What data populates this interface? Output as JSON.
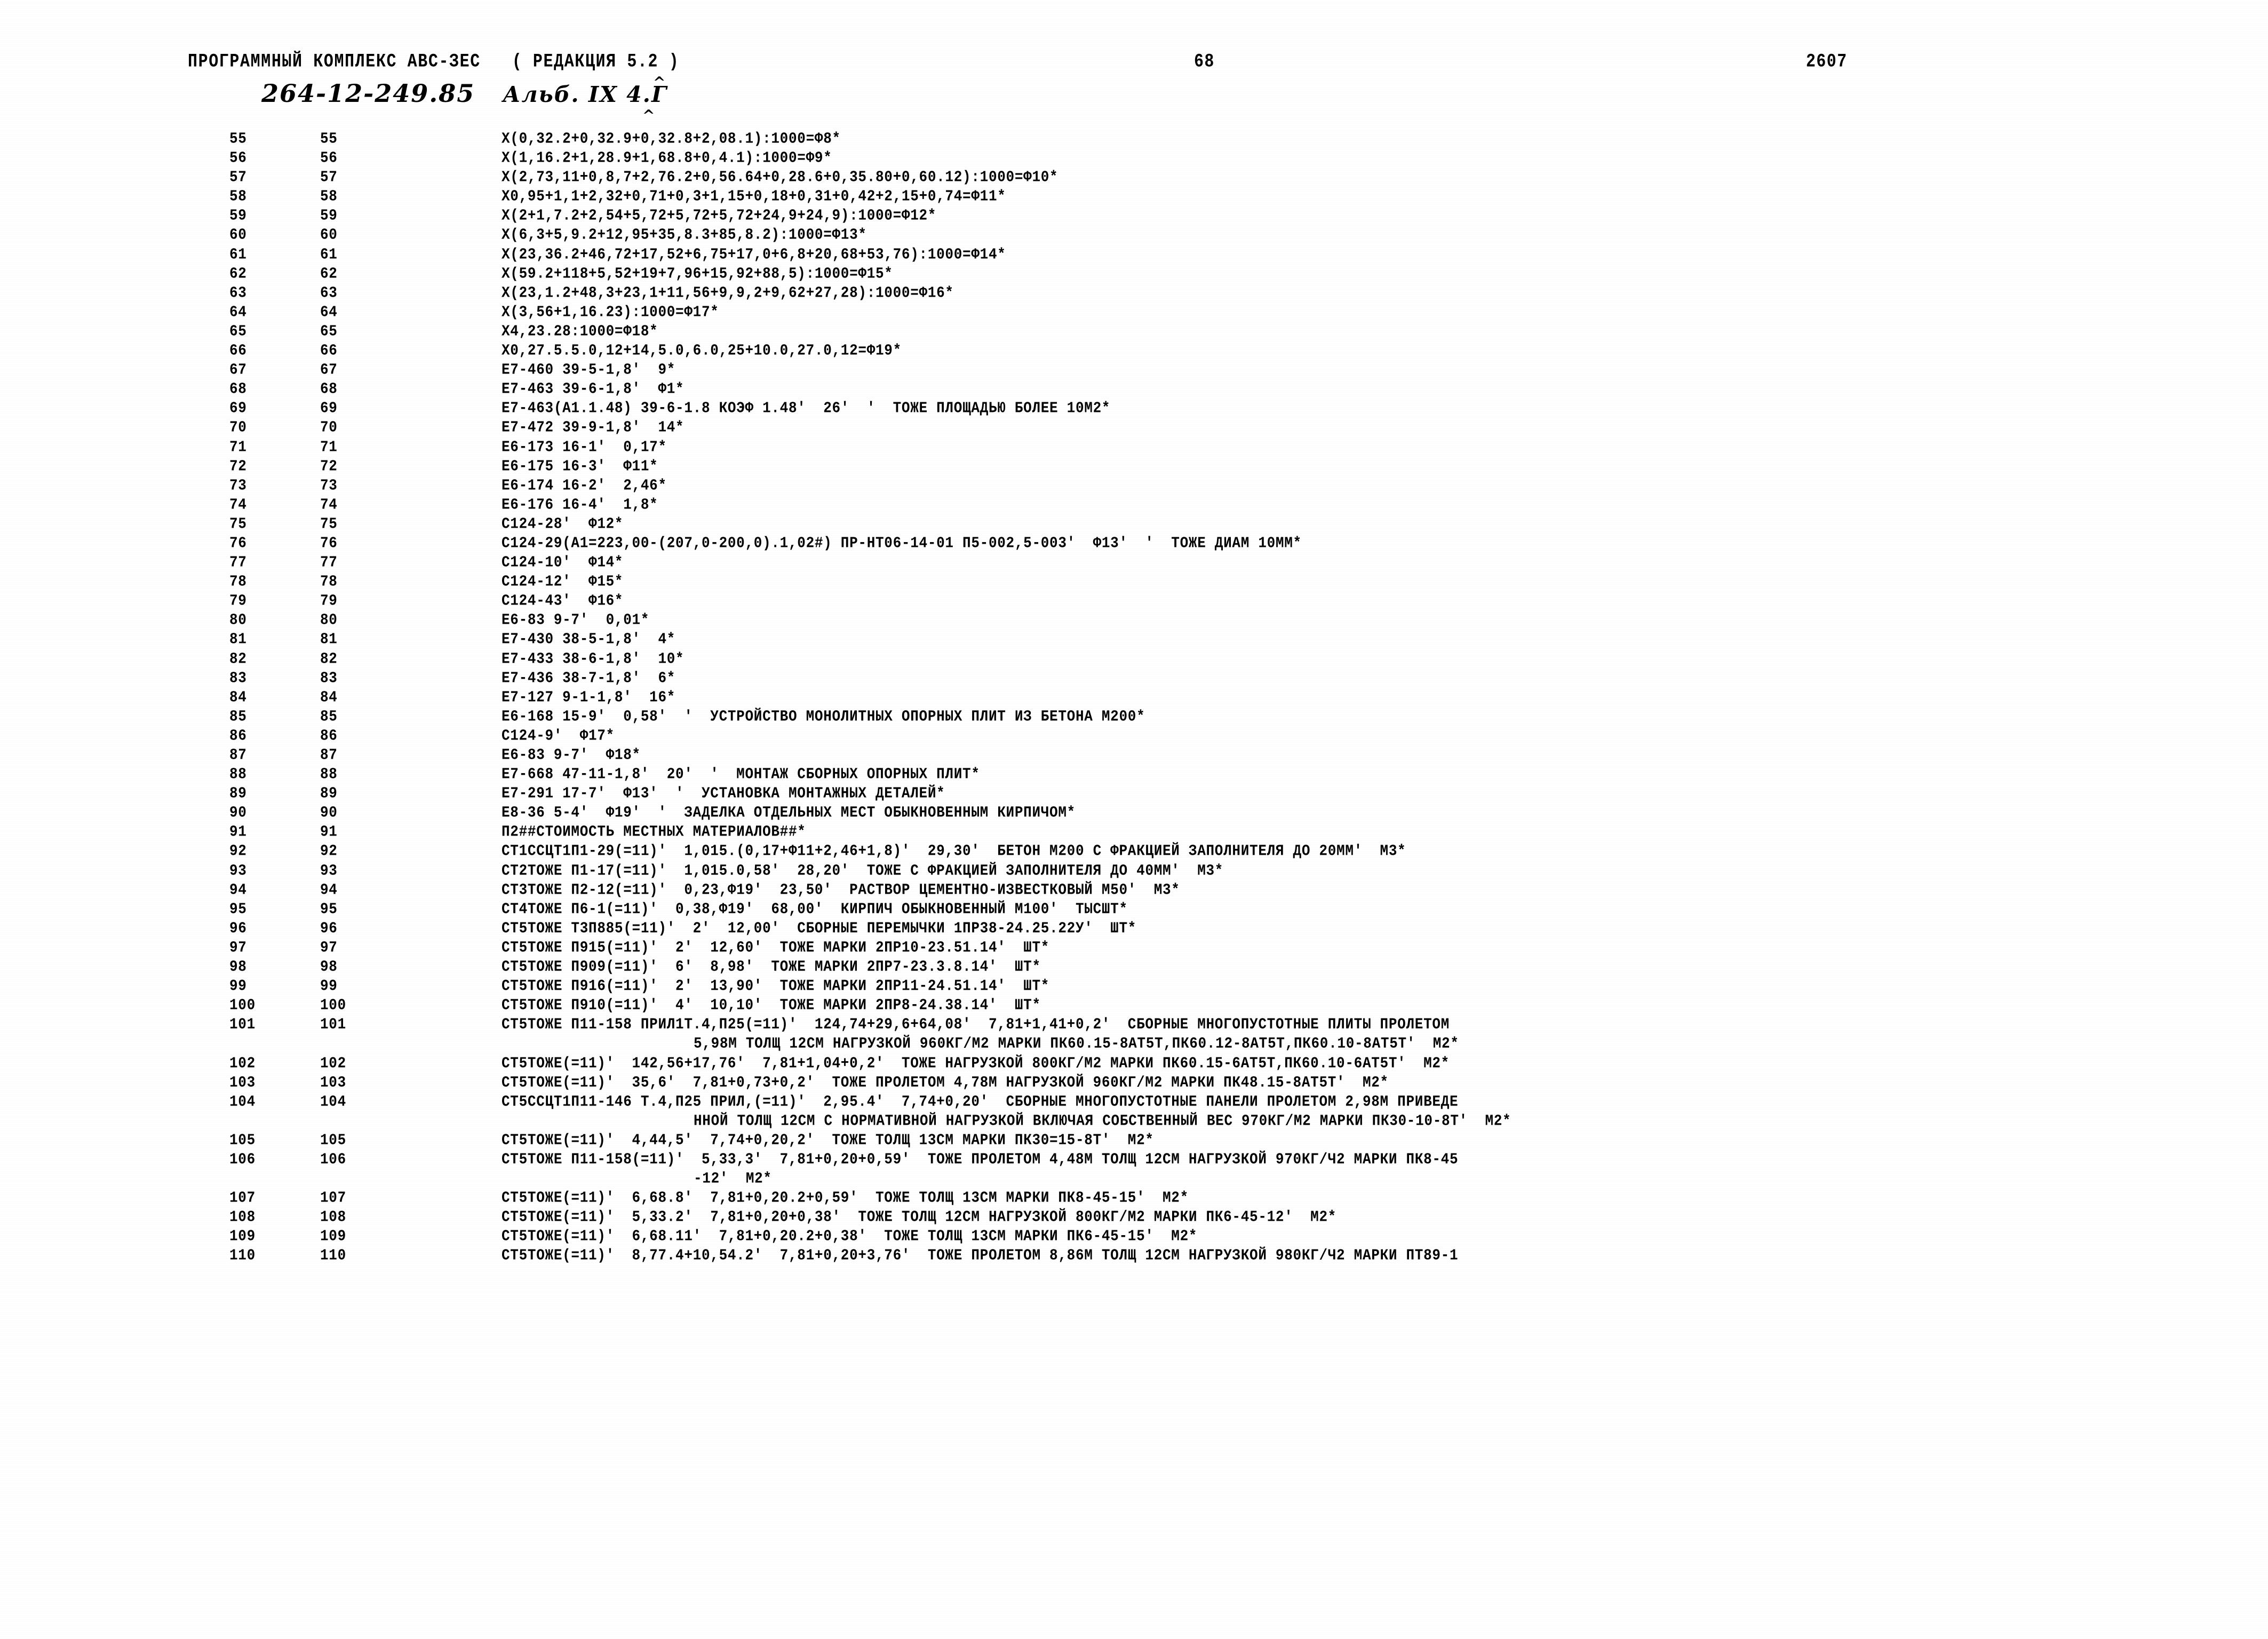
{
  "header": {
    "title": "ПРОГРАММНЫЙ КОМПЛЕКС АВС-ЗЕС   ( РЕДАКЦИЯ 5.2 )",
    "page_number": "68",
    "doc_code": "2607"
  },
  "annotation": {
    "handwritten_code": "264-12-249.85",
    "handwritten_album": "Альб. IX 4.Г",
    "mark_above": "^",
    "mark_below": "^"
  },
  "listing": {
    "rows": [
      {
        "a": "55",
        "b": "55",
        "c": "X(0,32.2+0,32.9+0,32.8+2,08.1):1000=Ф8*"
      },
      {
        "a": "56",
        "b": "56",
        "c": "X(1,16.2+1,28.9+1,68.8+0,4.1):1000=Ф9*"
      },
      {
        "a": "57",
        "b": "57",
        "c": "X(2,73,11+0,8,7+2,76.2+0,56.64+0,28.6+0,35.80+0,60.12):1000=Ф10*"
      },
      {
        "a": "58",
        "b": "58",
        "c": "X0,95+1,1+2,32+0,71+0,3+1,15+0,18+0,31+0,42+2,15+0,74=Ф11*"
      },
      {
        "a": "59",
        "b": "59",
        "c": "X(2+1,7.2+2,54+5,72+5,72+5,72+24,9+24,9):1000=Ф12*"
      },
      {
        "a": "60",
        "b": "60",
        "c": "X(6,3+5,9.2+12,95+35,8.3+85,8.2):1000=Ф13*"
      },
      {
        "a": "61",
        "b": "61",
        "c": "X(23,36.2+46,72+17,52+6,75+17,0+6,8+20,68+53,76):1000=Ф14*"
      },
      {
        "a": "62",
        "b": "62",
        "c": "X(59.2+118+5,52+19+7,96+15,92+88,5):1000=Ф15*"
      },
      {
        "a": "63",
        "b": "63",
        "c": "X(23,1.2+48,3+23,1+11,56+9,9,2+9,62+27,28):1000=Ф16*"
      },
      {
        "a": "64",
        "b": "64",
        "c": "X(3,56+1,16.23):1000=Ф17*"
      },
      {
        "a": "65",
        "b": "65",
        "c": "X4,23.28:1000=Ф18*"
      },
      {
        "a": "66",
        "b": "66",
        "c": "X0,27.5.5.0,12+14,5.0,6.0,25+10.0,27.0,12=Ф19*"
      },
      {
        "a": "67",
        "b": "67",
        "c": "E7-460 39-5-1,8'  9*"
      },
      {
        "a": "68",
        "b": "68",
        "c": "E7-463 39-6-1,8'  Ф1*"
      },
      {
        "a": "69",
        "b": "69",
        "c": "E7-463(A1.1.48) 39-6-1.8 КОЭФ 1.48'  26'  '  ТОЖЕ ПЛОЩАДЬЮ БОЛЕЕ 10М2*"
      },
      {
        "a": "70",
        "b": "70",
        "c": "E7-472 39-9-1,8'  14*"
      },
      {
        "a": "71",
        "b": "71",
        "c": "E6-173 16-1'  0,17*"
      },
      {
        "a": "72",
        "b": "72",
        "c": "E6-175 16-3'  Ф11*"
      },
      {
        "a": "73",
        "b": "73",
        "c": "E6-174 16-2'  2,46*"
      },
      {
        "a": "74",
        "b": "74",
        "c": "E6-176 16-4'  1,8*"
      },
      {
        "a": "75",
        "b": "75",
        "c": "C124-28'  Ф12*"
      },
      {
        "a": "76",
        "b": "76",
        "c": "C124-29(A1=223,00-(207,0-200,0).1,02#) ПР-НТ06-14-01 П5-002,5-003'  Ф13'  '  ТОЖЕ ДИАМ 10ММ*"
      },
      {
        "a": "77",
        "b": "77",
        "c": "C124-10'  Ф14*"
      },
      {
        "a": "78",
        "b": "78",
        "c": "C124-12'  Ф15*"
      },
      {
        "a": "79",
        "b": "79",
        "c": "C124-43'  Ф16*"
      },
      {
        "a": "80",
        "b": "80",
        "c": "E6-83 9-7'  0,01*"
      },
      {
        "a": "81",
        "b": "81",
        "c": "E7-430 38-5-1,8'  4*"
      },
      {
        "a": "82",
        "b": "82",
        "c": "E7-433 38-6-1,8'  10*"
      },
      {
        "a": "83",
        "b": "83",
        "c": "E7-436 38-7-1,8'  6*"
      },
      {
        "a": "84",
        "b": "84",
        "c": "E7-127 9-1-1,8'  16*"
      },
      {
        "a": "85",
        "b": "85",
        "c": "E6-168 15-9'  0,58'  '  УСТРОЙСТВО МОНОЛИТНЫХ ОПОРНЫХ ПЛИТ ИЗ БЕТОНА М200*"
      },
      {
        "a": "86",
        "b": "86",
        "c": "C124-9'  Ф17*"
      },
      {
        "a": "87",
        "b": "87",
        "c": "E6-83 9-7'  Ф18*"
      },
      {
        "a": "88",
        "b": "88",
        "c": "E7-668 47-11-1,8'  20'  '  МОНТАЖ СБОРНЫХ ОПОРНЫХ ПЛИТ*"
      },
      {
        "a": "89",
        "b": "89",
        "c": "E7-291 17-7'  Ф13'  '  УСТАНОВКА МОНТАЖНЫХ ДЕТАЛЕЙ*"
      },
      {
        "a": "90",
        "b": "90",
        "c": "E8-36 5-4'  Ф19'  '  ЗАДЕЛКА ОТДЕЛЬНЫХ МЕСТ ОБЫКНОВЕННЫМ КИРПИЧОМ*"
      },
      {
        "a": "91",
        "b": "91",
        "c": "П2##СТОИМОСТЬ МЕСТНЫХ МАТЕРИАЛОВ##*"
      },
      {
        "a": "92",
        "b": "92",
        "c": "СТ1ССЦТ1П1-29(=11)'  1,015.(0,17+Ф11+2,46+1,8)'  29,30'  БЕТОН М200 С ФРАКЦИЕЙ ЗАПОЛНИТЕЛЯ ДО 20ММ'  М3*"
      },
      {
        "a": "93",
        "b": "93",
        "c": "СТ2ТОЖЕ П1-17(=11)'  1,015.0,58'  28,20'  ТОЖЕ С ФРАКЦИЕЙ ЗАПОЛНИТЕЛЯ ДО 40ММ'  М3*"
      },
      {
        "a": "94",
        "b": "94",
        "c": "СТ3ТОЖЕ П2-12(=11)'  0,23,Ф19'  23,50'  РАСТВОР ЦЕМЕНТНО-ИЗВЕСТКОВЫЙ М50'  М3*"
      },
      {
        "a": "95",
        "b": "95",
        "c": "СТ4ТОЖЕ П6-1(=11)'  0,38,Ф19'  68,00'  КИРПИЧ ОБЫКНОВЕННЫЙ М100'  ТЫСШТ*"
      },
      {
        "a": "96",
        "b": "96",
        "c": "СТ5ТОЖЕ Т3П885(=11)'  2'  12,00'  СБОРНЫЕ ПЕРЕМЫЧКИ 1ПР38-24.25.22У'  ШТ*"
      },
      {
        "a": "97",
        "b": "97",
        "c": "СТ5ТОЖЕ П915(=11)'  2'  12,60'  ТОЖЕ МАРКИ 2ПР10-23.51.14'  ШТ*"
      },
      {
        "a": "98",
        "b": "98",
        "c": "СТ5ТОЖЕ П909(=11)'  6'  8,98'  ТОЖЕ МАРКИ 2ПР7-23.3.8.14'  ШТ*"
      },
      {
        "a": "99",
        "b": "99",
        "c": "СТ5ТОЖЕ П916(=11)'  2'  13,90'  ТОЖЕ МАРКИ 2ПР11-24.51.14'  ШТ*"
      },
      {
        "a": "100",
        "b": "100",
        "c": "СТ5ТОЖЕ П910(=11)'  4'  10,10'  ТОЖЕ МАРКИ 2ПР8-24.38.14'  ШТ*"
      },
      {
        "a": "101",
        "b": "101",
        "c": "СТ5ТОЖЕ П11-158 ПРИЛ1Т.4,П25(=11)'  124,74+29,6+64,08'  7,81+1,41+0,2'  СБОРНЫЕ МНОГОПУСТОТНЫЕ ПЛИТЫ ПРОЛЕТОМ"
      },
      {
        "a": "",
        "b": "",
        "c": "5,98М ТОЛЩ 12СМ НАГРУЗКОЙ 960КГ/М2 МАРКИ ПК60.15-8АТ5Т,ПК60.12-8АТ5Т,ПК60.10-8АТ5Т'  М2*",
        "cont": true
      },
      {
        "a": "102",
        "b": "102",
        "c": "СТ5ТОЖЕ(=11)'  142,56+17,76'  7,81+1,04+0,2'  ТОЖЕ НАГРУЗКОЙ 800КГ/М2 МАРКИ ПК60.15-6АТ5Т,ПК60.10-6АТ5Т'  М2*"
      },
      {
        "a": "103",
        "b": "103",
        "c": "СТ5ТОЖЕ(=11)'  35,6'  7,81+0,73+0,2'  ТОЖЕ ПРОЛЕТОМ 4,78М НАГРУЗКОЙ 960КГ/М2 МАРКИ ПК48.15-8АТ5Т'  М2*"
      },
      {
        "a": "104",
        "b": "104",
        "c": "СТ5ССЦТ1П11-146 Т.4,П25 ПРИЛ,(=11)'  2,95.4'  7,74+0,20'  СБОРНЫЕ МНОГОПУСТОТНЫЕ ПАНЕЛИ ПРОЛЕТОМ 2,98М ПРИВЕДЕ"
      },
      {
        "a": "",
        "b": "",
        "c": "ННОЙ ТОЛЩ 12СМ С НОРМАТИВНОЙ НАГРУЗКОЙ ВКЛЮЧАЯ СОБСТВЕННЫЙ ВЕС 970КГ/М2 МАРКИ ПК30-10-8Т'  М2*",
        "cont": true
      },
      {
        "a": "105",
        "b": "105",
        "c": "СТ5ТОЖЕ(=11)'  4,44,5'  7,74+0,20,2'  ТОЖЕ ТОЛЩ 13СМ МАРКИ ПК30=15-8Т'  М2*"
      },
      {
        "a": "106",
        "b": "106",
        "c": "СТ5ТОЖЕ П11-158(=11)'  5,33,3'  7,81+0,20+0,59'  ТОЖЕ ПРОЛЕТОМ 4,48М ТОЛЩ 12СМ НАГРУЗКОЙ 970КГ/Ч2 МАРКИ ПК8-45"
      },
      {
        "a": "",
        "b": "",
        "c": "-12'  М2*",
        "cont": true
      },
      {
        "a": "107",
        "b": "107",
        "c": "СТ5ТОЖЕ(=11)'  6,68.8'  7,81+0,20.2+0,59'  ТОЖЕ ТОЛЩ 13СМ МАРКИ ПК8-45-15'  М2*"
      },
      {
        "a": "108",
        "b": "108",
        "c": "СТ5ТОЖЕ(=11)'  5,33.2'  7,81+0,20+0,38'  ТОЖЕ ТОЛЩ 12СМ НАГРУЗКОЙ 800КГ/М2 МАРКИ ПК6-45-12'  М2*"
      },
      {
        "a": "109",
        "b": "109",
        "c": "СТ5ТОЖЕ(=11)'  6,68.11'  7,81+0,20.2+0,38'  ТОЖЕ ТОЛЩ 13СМ МАРКИ ПК6-45-15'  М2*"
      },
      {
        "a": "110",
        "b": "110",
        "c": "СТ5ТОЖЕ(=11)'  8,77.4+10,54.2'  7,81+0,20+3,76'  ТОЖЕ ПРОЛЕТОМ 8,86М ТОЛЩ 12СМ НАГРУЗКОЙ 980КГ/Ч2 МАРКИ ПТ89-1"
      }
    ]
  }
}
